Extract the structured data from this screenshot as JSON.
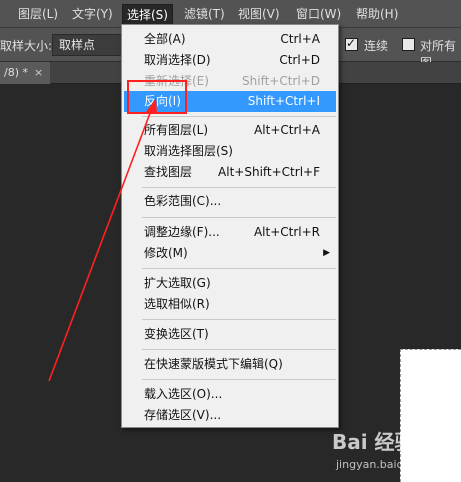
{
  "menubar": {
    "items": [
      "图层(L)",
      "文字(Y)",
      "选择(S)",
      "滤镜(T)",
      "视图(V)",
      "窗口(W)",
      "帮助(H)"
    ],
    "active": "选择(S)"
  },
  "optionsbar": {
    "sample_size_label": "取样大小:",
    "sample_size_value": "取样点",
    "contiguous_label": "连续",
    "all_layers_label": "对所有图"
  },
  "tab": {
    "title": "/8) *",
    "close": "×"
  },
  "dropdown": {
    "items": [
      {
        "label": "全部(A)",
        "shortcut": "Ctrl+A",
        "state": "normal"
      },
      {
        "label": "取消选择(D)",
        "shortcut": "Ctrl+D",
        "state": "normal"
      },
      {
        "label": "重新选择(E)",
        "shortcut": "Shift+Ctrl+D",
        "state": "disabled"
      },
      {
        "label": "反向(I)",
        "shortcut": "Shift+Ctrl+I",
        "state": "highlight"
      },
      {
        "label": "所有图层(L)",
        "shortcut": "Alt+Ctrl+A",
        "state": "normal"
      },
      {
        "label": "取消选择图层(S)",
        "shortcut": "",
        "state": "normal"
      },
      {
        "label": "查找图层",
        "shortcut": "Alt+Shift+Ctrl+F",
        "state": "normal"
      },
      {
        "label": "色彩范围(C)...",
        "shortcut": "",
        "state": "normal"
      },
      {
        "label": "调整边缘(F)...",
        "shortcut": "Alt+Ctrl+R",
        "state": "normal"
      },
      {
        "label": "修改(M)",
        "shortcut": "",
        "state": "submenu"
      },
      {
        "label": "扩大选取(G)",
        "shortcut": "",
        "state": "normal"
      },
      {
        "label": "选取相似(R)",
        "shortcut": "",
        "state": "normal"
      },
      {
        "label": "变换选区(T)",
        "shortcut": "",
        "state": "normal"
      },
      {
        "label": "在快速蒙版模式下编辑(Q)",
        "shortcut": "",
        "state": "normal"
      },
      {
        "label": "载入选区(O)...",
        "shortcut": "",
        "state": "normal"
      },
      {
        "label": "存储选区(V)...",
        "shortcut": "",
        "state": "normal"
      }
    ]
  },
  "watermark": {
    "logo": "Bai 经验",
    "url": "jingyan.baidu.com"
  },
  "colors": {
    "highlight": "#3399ff",
    "annotation": "#ff2020"
  },
  "icons": {
    "submenu": "chevron-right-icon",
    "checkbox": "checkmark-icon"
  }
}
